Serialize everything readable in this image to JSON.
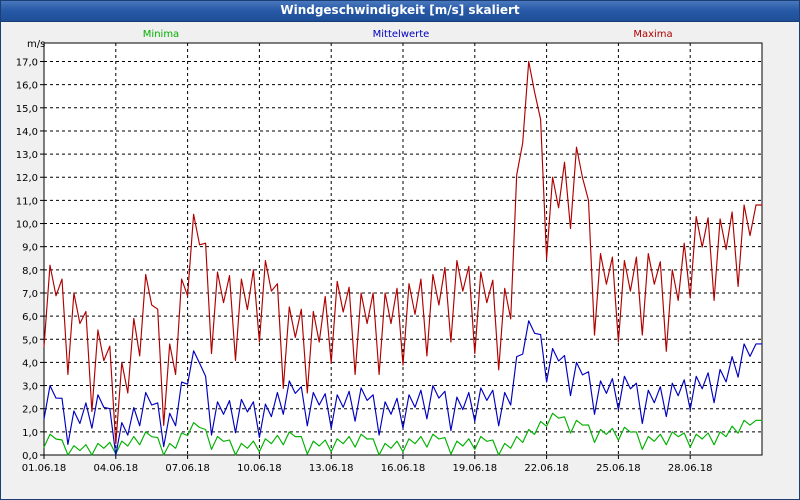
{
  "window": {
    "title": "Windgeschwindigkeit [m/s] skaliert"
  },
  "chart_data": {
    "type": "line",
    "title": "Windgeschwindigkeit [m/s] skaliert",
    "ylabel": "m/s",
    "ylim": [
      0,
      17.8
    ],
    "y_ticks": [
      "0,0",
      "1,0",
      "2,0",
      "3,0",
      "4,0",
      "5,0",
      "6,0",
      "7,0",
      "8,0",
      "9,0",
      "10,0",
      "11,0",
      "12,0",
      "13,0",
      "14,0",
      "15,0",
      "16,0",
      "17,0"
    ],
    "x_ticks": [
      "01.06.18",
      "04.06.18",
      "07.06.18",
      "10.06.18",
      "13.06.18",
      "16.06.18",
      "19.06.18",
      "22.06.18",
      "25.06.18",
      "28.06.18"
    ],
    "xlim": [
      "01.06.18",
      "01.07.18"
    ],
    "grid": true,
    "legend_position": "top",
    "series": [
      {
        "name": "Minima",
        "color": "#00b000",
        "x": [
          "01.06.18",
          "02.06.18",
          "03.06.18",
          "04.06.18",
          "05.06.18",
          "06.06.18",
          "07.06.18",
          "08.06.18",
          "09.06.18",
          "10.06.18",
          "11.06.18",
          "12.06.18",
          "13.06.18",
          "14.06.18",
          "15.06.18",
          "16.06.18",
          "17.06.18",
          "18.06.18",
          "19.06.18",
          "20.06.18",
          "21.06.18",
          "22.06.18",
          "23.06.18",
          "24.06.18",
          "25.06.18",
          "26.06.18",
          "27.06.18",
          "28.06.18",
          "29.06.18",
          "30.06.18"
        ],
        "values": [
          0.9,
          0.4,
          0.5,
          0.6,
          1.0,
          0.5,
          1.4,
          0.8,
          0.5,
          0.7,
          1.0,
          0.6,
          0.7,
          0.9,
          0.5,
          0.7,
          0.9,
          0.6,
          0.8,
          0.5,
          1.1,
          1.8,
          1.5,
          1.1,
          1.2,
          0.8,
          1.0,
          0.9,
          1.0,
          1.5
        ]
      },
      {
        "name": "Mittelwerte",
        "color": "#0000c0",
        "x": [
          "01.06.18",
          "02.06.18",
          "03.06.18",
          "04.06.18",
          "05.06.18",
          "06.06.18",
          "07.06.18",
          "08.06.18",
          "09.06.18",
          "10.06.18",
          "11.06.18",
          "12.06.18",
          "13.06.18",
          "14.06.18",
          "15.06.18",
          "16.06.18",
          "17.06.18",
          "18.06.18",
          "19.06.18",
          "20.06.18",
          "21.06.18",
          "22.06.18",
          "23.06.18",
          "24.06.18",
          "25.06.18",
          "26.06.18",
          "27.06.18",
          "28.06.18",
          "29.06.18",
          "30.06.18"
        ],
        "values": [
          3.0,
          1.9,
          2.6,
          1.4,
          2.7,
          1.8,
          4.5,
          2.3,
          2.4,
          2.2,
          3.2,
          2.7,
          2.6,
          2.9,
          2.3,
          2.6,
          3.0,
          2.5,
          2.9,
          2.7,
          5.8,
          4.6,
          4.0,
          3.2,
          3.4,
          2.8,
          3.1,
          3.4,
          3.7,
          4.8
        ]
      },
      {
        "name": "Maxima",
        "color": "#b00000",
        "x": [
          "01.06.18",
          "02.06.18",
          "03.06.18",
          "04.06.18",
          "05.06.18",
          "06.06.18",
          "07.06.18",
          "08.06.18",
          "09.06.18",
          "10.06.18",
          "11.06.18",
          "12.06.18",
          "13.06.18",
          "14.06.18",
          "15.06.18",
          "16.06.18",
          "17.06.18",
          "18.06.18",
          "19.06.18",
          "20.06.18",
          "21.06.18",
          "22.06.18",
          "23.06.18",
          "24.06.18",
          "25.06.18",
          "26.06.18",
          "27.06.18",
          "28.06.18",
          "29.06.18",
          "30.06.18"
        ],
        "values": [
          8.2,
          7.0,
          5.4,
          4.0,
          7.8,
          4.8,
          10.4,
          7.9,
          7.6,
          8.4,
          6.4,
          6.2,
          7.5,
          7.0,
          7.0,
          7.4,
          7.8,
          8.4,
          7.9,
          7.2,
          17.0,
          12.0,
          13.3,
          8.7,
          8.4,
          8.7,
          8.0,
          10.3,
          10.2,
          10.8
        ]
      }
    ]
  }
}
